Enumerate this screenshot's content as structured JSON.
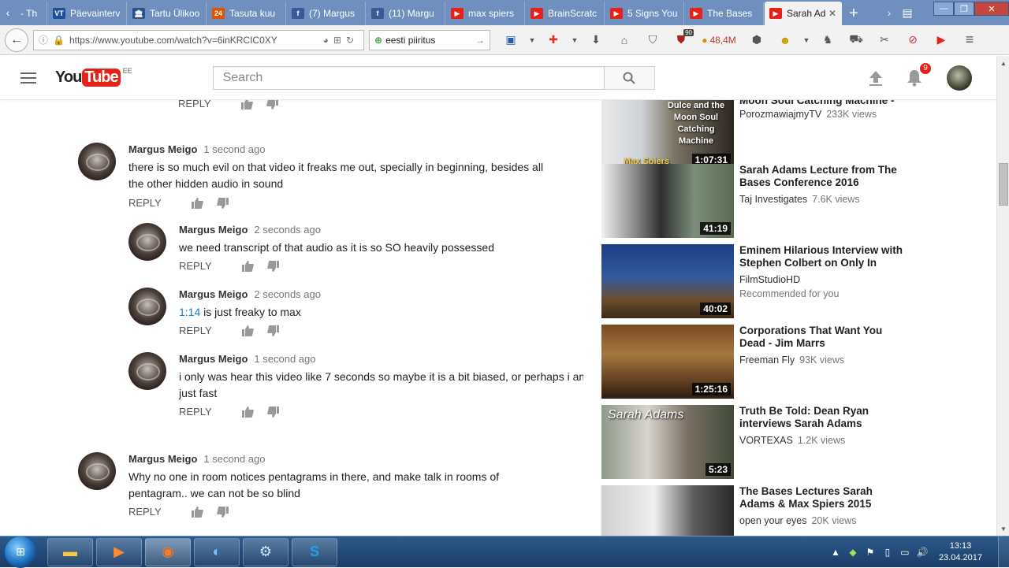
{
  "browser": {
    "tabs": [
      {
        "label": "- Th",
        "icon": "tab-favicon",
        "color": "#6f8fbe"
      },
      {
        "label": "Päevainterv",
        "icon": "vt-icon",
        "badge": "VT",
        "color": "#1f4e9c"
      },
      {
        "label": "Tartu Ülikoo",
        "icon": "university-icon",
        "badge": "🏛",
        "color": "#2d4f8a"
      },
      {
        "label": "Tasuta kuu",
        "icon": "24-icon",
        "badge": "24",
        "color": "#e65100"
      },
      {
        "label": "(7) Margus",
        "icon": "facebook-icon",
        "badge": "f",
        "color": "#3b5998"
      },
      {
        "label": "(11) Margu",
        "icon": "facebook-icon",
        "badge": "f",
        "color": "#3b5998"
      },
      {
        "label": "max spiers",
        "icon": "youtube-icon",
        "badge": "▶",
        "color": "#e62117"
      },
      {
        "label": "BrainScratc",
        "icon": "youtube-icon",
        "badge": "▶",
        "color": "#e62117"
      },
      {
        "label": "5 Signs You",
        "icon": "youtube-icon",
        "badge": "▶",
        "color": "#e62117"
      },
      {
        "label": "The Bases",
        "icon": "youtube-icon",
        "badge": "▶",
        "color": "#e62117"
      },
      {
        "label": "Sarah Ad",
        "icon": "youtube-icon",
        "badge": "▶",
        "color": "#e62117",
        "active": true
      }
    ],
    "url": "https://www.youtube.com/watch?v=6inKRCIC0XY",
    "search_value": "eesti  piiritus",
    "toolbar_badge": "90",
    "toolbar_counter": "48,4M"
  },
  "youtube": {
    "logo_you": "You",
    "logo_tube": "Tube",
    "country": "EE",
    "search_placeholder": "Search",
    "notification_count": "9"
  },
  "comments": {
    "reply_label": "REPLY",
    "items": [
      {
        "author": "Margus Meigo",
        "time": "1 second ago",
        "text": "there is so much evil on that video it freaks me out,  specially in beginning, besides all the other hidden audio in sound",
        "nested": false
      },
      {
        "author": "Margus Meigo",
        "time": "2 seconds ago",
        "text": "we need transcript of that audio as it is so SO heavily possessed",
        "nested": true
      },
      {
        "author": "Margus Meigo",
        "time": "2 seconds ago",
        "timestamp_link": "1:14",
        "text": " is just freaky to max",
        "nested": true
      },
      {
        "author": "Margus Meigo",
        "time": "1 second ago",
        "text": "i only was hear this video like 7 seconds so maybe it is a bit biased, or perhaps i am just fast",
        "nested": true
      },
      {
        "author": "Margus Meigo",
        "time": "1 second ago",
        "text": "Why no one in room notices pentagrams in there, and make talk in rooms  of pentagram.. we can not be so blind",
        "nested": false
      }
    ]
  },
  "related": [
    {
      "title": "Moon Soul Catching Machine -",
      "channel": "PorozmawiajmyTV",
      "views": "233K views",
      "duration": "1:07:31",
      "overlay": "Dulce and the Moon Soul Catching Machine",
      "overlay2": "Max Spiers"
    },
    {
      "title": "Sarah Adams Lecture from The Bases Conference 2016",
      "channel": "Taj Investigates",
      "views": "7.6K views",
      "duration": "41:19"
    },
    {
      "title": "Eminem Hilarious Interview with Stephen Colbert on Only In",
      "channel": "FilmStudioHD",
      "views": "",
      "sub": "Recommended for you",
      "duration": "40:02"
    },
    {
      "title": "Corporations That Want You Dead - Jim Marrs",
      "channel": "Freeman Fly",
      "views": "93K views",
      "duration": "1:25:16"
    },
    {
      "title": "Truth Be Told: Dean Ryan interviews Sarah Adams",
      "channel": "VORTEXAS",
      "views": "1.2K views",
      "duration": "5:23",
      "overlay": "Sarah Adams"
    },
    {
      "title": "The Bases Lectures Sarah Adams & Max Spiers 2015",
      "channel": "open your eyes",
      "views": "20K views",
      "duration": ""
    }
  ],
  "taskbar": {
    "time": "13:13",
    "date": "23.04.2017"
  }
}
